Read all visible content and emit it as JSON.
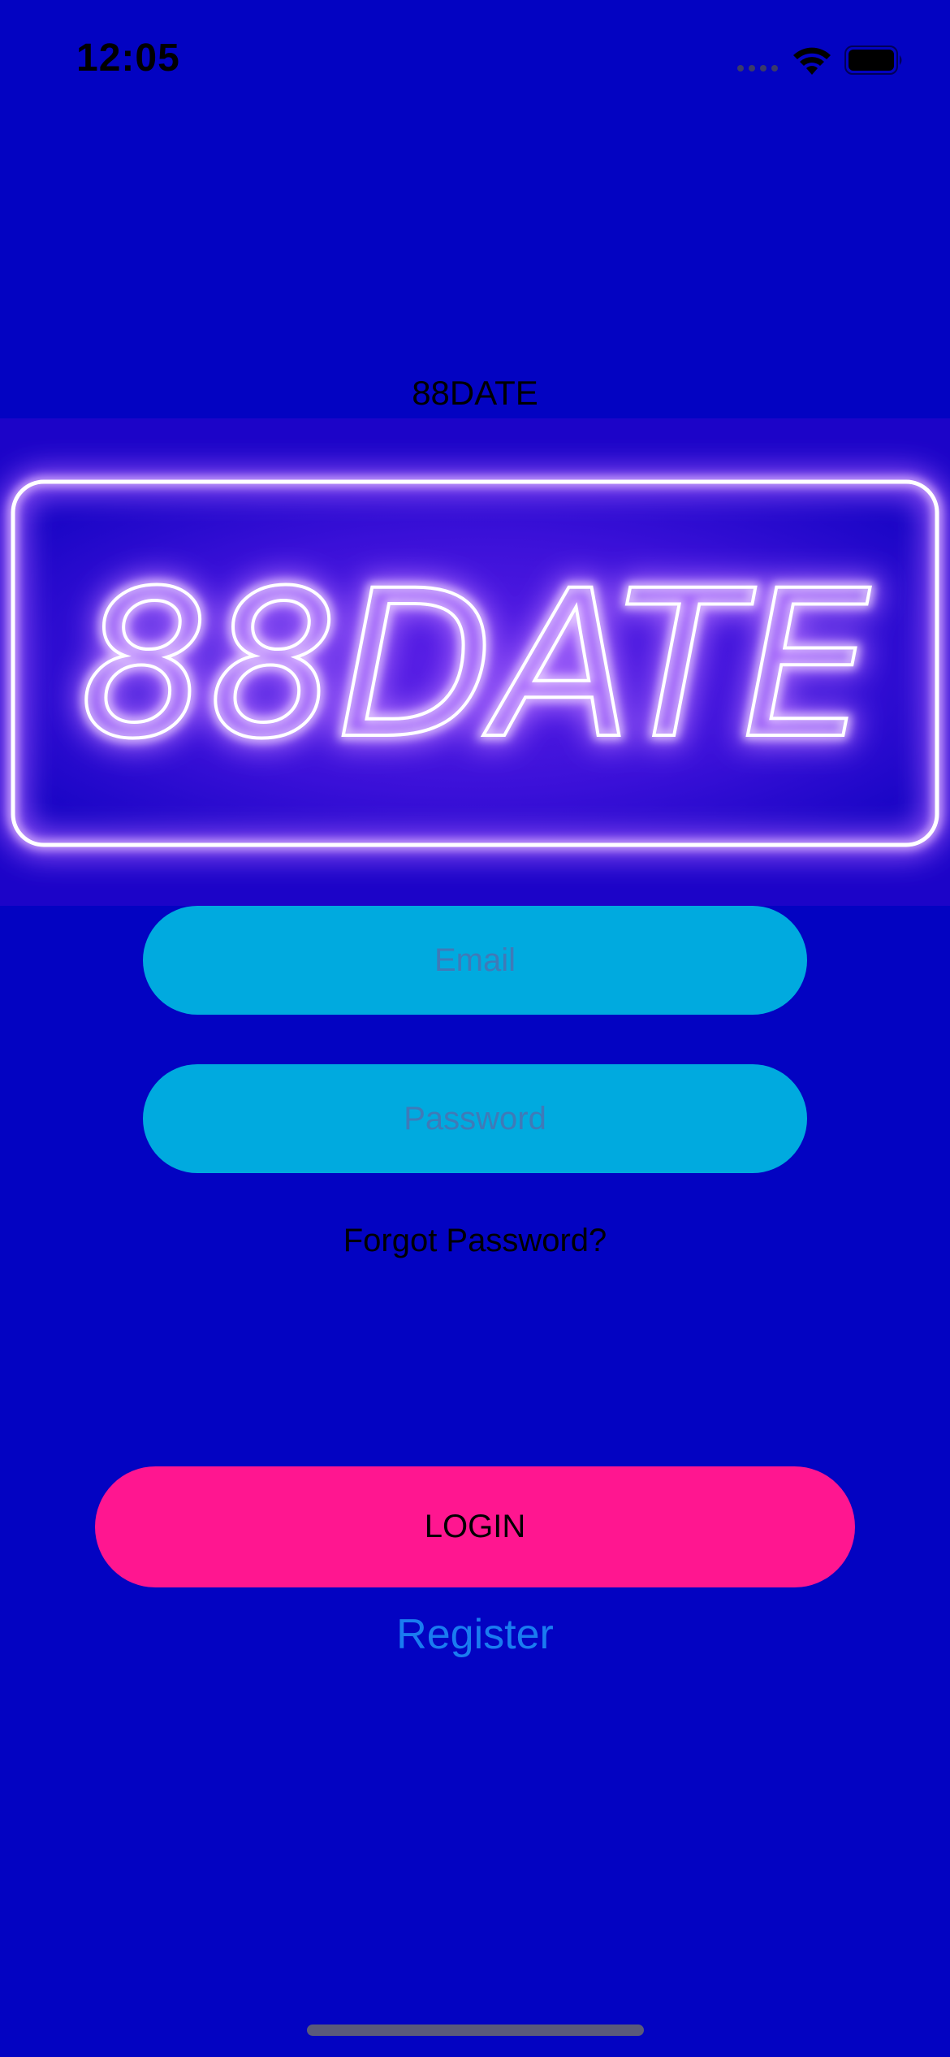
{
  "status_bar": {
    "time": "12:05",
    "icons": [
      "cellular-signal-icon",
      "wifi-icon",
      "battery-icon"
    ]
  },
  "app_title": "88DATE",
  "logo": {
    "text": "88DATE",
    "style": "neon-sign"
  },
  "form": {
    "email_placeholder": "Email",
    "password_placeholder": "Password",
    "forgot_password_label": "Forgot Password?",
    "login_label": "LOGIN",
    "register_label": "Register"
  },
  "colors": {
    "background": "#0303c2",
    "input_fill": "#00aadf",
    "login_button": "#ff1690",
    "register_link": "#1a7cf0",
    "neon_glow": "#b46bff"
  }
}
